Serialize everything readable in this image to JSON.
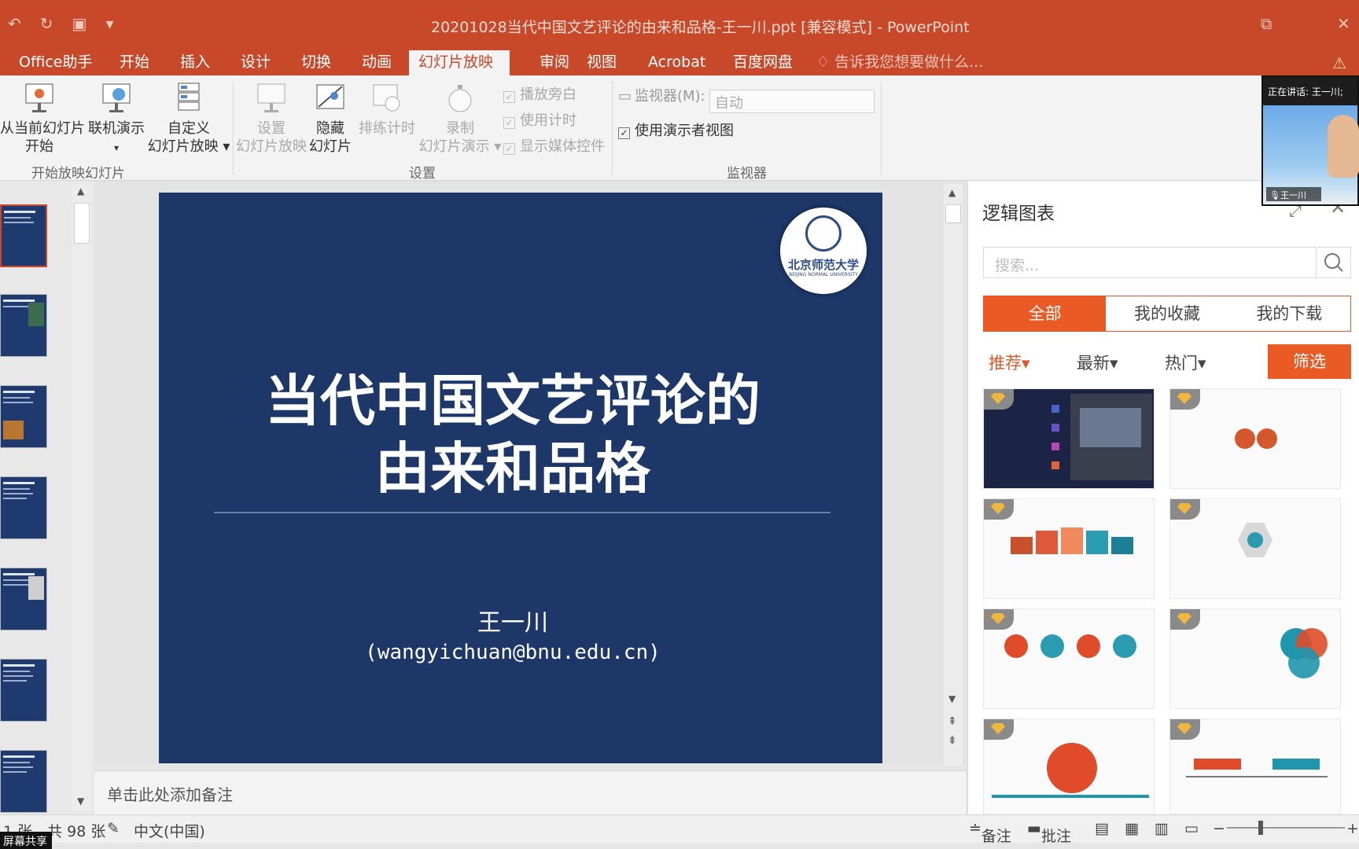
{
  "window": {
    "title": "20201028当代中国文艺评论的由来和品格-王一川.ppt [兼容模式] - PowerPoint",
    "restore_glyph": "⧉",
    "close_glyph": "✕"
  },
  "tabs": [
    "Office助手",
    "开始",
    "插入",
    "设计",
    "切换",
    "动画",
    "幻灯片放映",
    "审阅",
    "视图",
    "Acrobat",
    "百度网盘"
  ],
  "tell_me": "告诉我您想要做什么...",
  "ribbon": {
    "from_current_1": "从当前幻灯片",
    "from_current_2": "开始",
    "online_1": "联机演示",
    "online_2": "▾",
    "custom_1": "自定义",
    "custom_2": "幻灯片放映 ▾",
    "group_start": "开始放映幻灯片",
    "setup_1": "设置",
    "setup_2": "幻灯片放映",
    "hide_1": "隐藏",
    "hide_2": "幻灯片",
    "rehearse": "排练计时",
    "record_1": "录制",
    "record_2": "幻灯片演示 ▾",
    "play_narration": "播放旁白",
    "use_timings": "使用计时",
    "show_media": "显示媒体控件",
    "group_setup": "设置",
    "monitor_label": "监视器(M):",
    "monitor_value": "自动",
    "presenter_view": "使用演示者视图",
    "group_monitor": "监视器"
  },
  "slide": {
    "logo_text": "北京师范大学",
    "logo_sub": "BEIJING NORMAL UNIVERSITY",
    "title_line1": "当代中国文艺评论的",
    "title_line2": "由来和品格",
    "author": "王一川",
    "email": "(wangyichuan@bnu.edu.cn)"
  },
  "notes_placeholder": "单击此处添加备注",
  "pane": {
    "title": "逻辑图表",
    "search_placeholder": "搜索...",
    "tabs": [
      "全部",
      "我的收藏",
      "我的下载"
    ],
    "filters": [
      "推荐▾",
      "最新▾",
      "热门▾"
    ],
    "filter_button": "筛选"
  },
  "video": {
    "speaking": "正在讲话: 王一川;",
    "name": "王一川"
  },
  "status": {
    "slide_pos": "1 张，共 98 张",
    "language": "中文(中国)",
    "notes": "备注",
    "comments": "批注",
    "screen_share": "屏幕共享"
  }
}
